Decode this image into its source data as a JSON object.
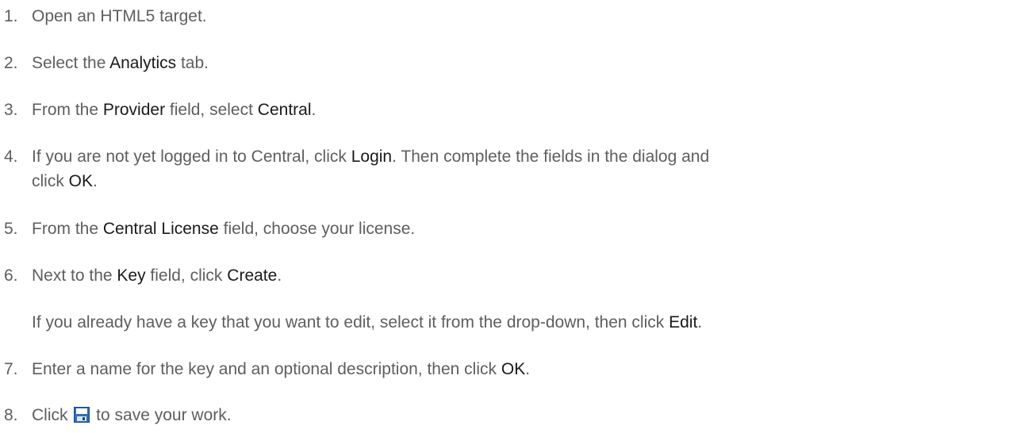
{
  "steps": [
    {
      "num": "1.",
      "parts": [
        "Open an HTML5 target."
      ]
    },
    {
      "num": "2.",
      "pre": "Select the ",
      "b1": "Analytics",
      "post": " tab."
    },
    {
      "num": "3.",
      "pre": "From the ",
      "b1": "Provider",
      "mid": " field, select ",
      "b2": "Central",
      "post": "."
    },
    {
      "num": "4.",
      "pre": "If you are not yet logged in to Central, click ",
      "b1": "Login",
      "mid": ". Then complete the fields in the dialog and",
      "line2pre": "click ",
      "b2": "OK",
      "post": "."
    },
    {
      "num": "5.",
      "pre": "From the ",
      "b1": "Central License",
      "post": " field, choose your license."
    },
    {
      "num": "6.",
      "pre": "Next to the ",
      "b1": "Key",
      "mid": " field, click ",
      "b2": "Create",
      "post": ".",
      "note_pre": "If you already have a key that you want to edit, select it from the drop-down, then click ",
      "note_b": "Edit",
      "note_post": "."
    },
    {
      "num": "7.",
      "pre": "Enter a name for the key and an optional description, then click ",
      "b1": "OK",
      "post": "."
    },
    {
      "num": "8.",
      "pre": "Click ",
      "icon": "save-icon",
      "post": " to save your work."
    }
  ]
}
